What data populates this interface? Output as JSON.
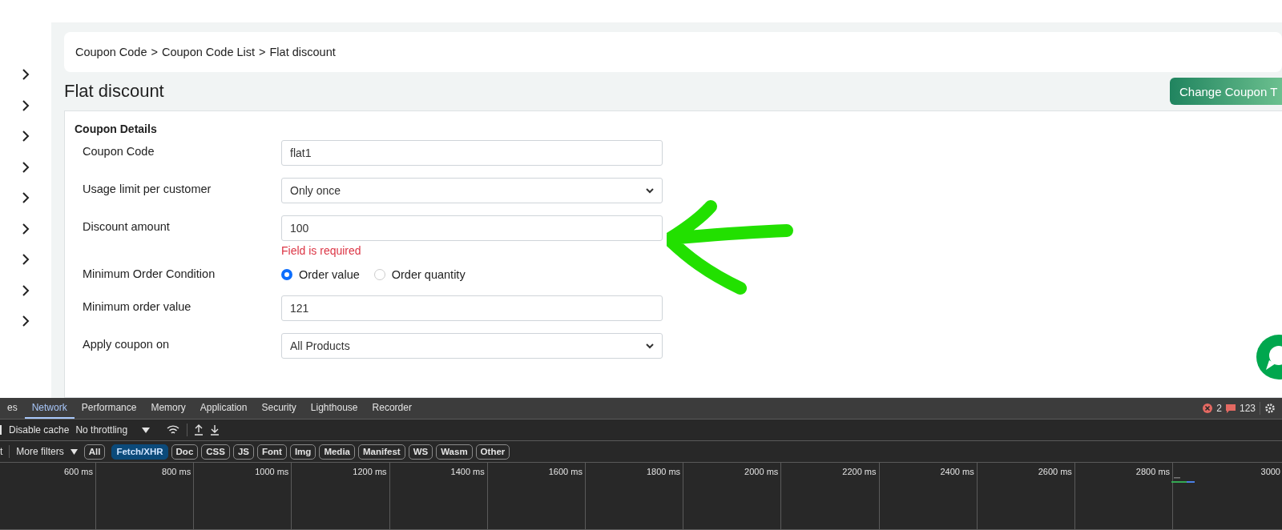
{
  "sidebar": {
    "items": [
      {
        "expanded": false
      },
      {
        "expanded": false
      },
      {
        "expanded": false
      },
      {
        "expanded": false
      },
      {
        "expanded": false
      },
      {
        "expanded": false
      },
      {
        "expanded": false
      },
      {
        "expanded": false
      },
      {
        "expanded": false
      }
    ]
  },
  "breadcrumb": [
    "Coupon Code",
    "Coupon Code List",
    "Flat discount"
  ],
  "breadcrumb_separator": ">",
  "page_title": "Flat discount",
  "change_button": "Change Coupon T",
  "section_title": "Coupon Details",
  "fields": [
    {
      "kind": "text",
      "label": "Coupon Code",
      "value": "flat1"
    },
    {
      "kind": "select",
      "label": "Usage limit per customer",
      "value": "Only once"
    },
    {
      "kind": "text",
      "label": "Discount amount",
      "value": "100",
      "error": "Field is required"
    },
    {
      "kind": "radio",
      "label": "Minimum Order Condition",
      "options": [
        {
          "label": "Order value",
          "selected": true
        },
        {
          "label": "Order quantity",
          "selected": false
        }
      ]
    },
    {
      "kind": "text",
      "label": "Minimum order value",
      "value": "121"
    },
    {
      "kind": "select",
      "label": "Apply coupon on",
      "value": "All Products"
    }
  ],
  "devtools": {
    "tabs": [
      {
        "label": "es",
        "selected": false
      },
      {
        "label": "Network",
        "selected": true
      },
      {
        "label": "Performance",
        "selected": false
      },
      {
        "label": "Memory",
        "selected": false
      },
      {
        "label": "Application",
        "selected": false
      },
      {
        "label": "Security",
        "selected": false
      },
      {
        "label": "Lighthouse",
        "selected": false
      },
      {
        "label": "Recorder",
        "selected": false
      }
    ],
    "errors": "2",
    "issues": "123",
    "disable_cache": "Disable cache",
    "throttling": "No throttling",
    "filter_cut": "t",
    "more_filters": "More filters",
    "filters": [
      {
        "label": "All",
        "selected": false
      },
      {
        "label": "Fetch/XHR",
        "selected": true
      },
      {
        "label": "Doc",
        "selected": false
      },
      {
        "label": "CSS",
        "selected": false
      },
      {
        "label": "JS",
        "selected": false
      },
      {
        "label": "Font",
        "selected": false
      },
      {
        "label": "Img",
        "selected": false
      },
      {
        "label": "Media",
        "selected": false
      },
      {
        "label": "Manifest",
        "selected": false
      },
      {
        "label": "WS",
        "selected": false
      },
      {
        "label": "Wasm",
        "selected": false
      },
      {
        "label": "Other",
        "selected": false
      }
    ],
    "timeline_ticks": [
      "600 ms",
      "800 ms",
      "1000 ms",
      "1200 ms",
      "1400 ms",
      "1600 ms",
      "1800 ms",
      "2000 ms",
      "2200 ms",
      "2400 ms",
      "2600 ms",
      "2800 ms",
      "3000"
    ]
  }
}
